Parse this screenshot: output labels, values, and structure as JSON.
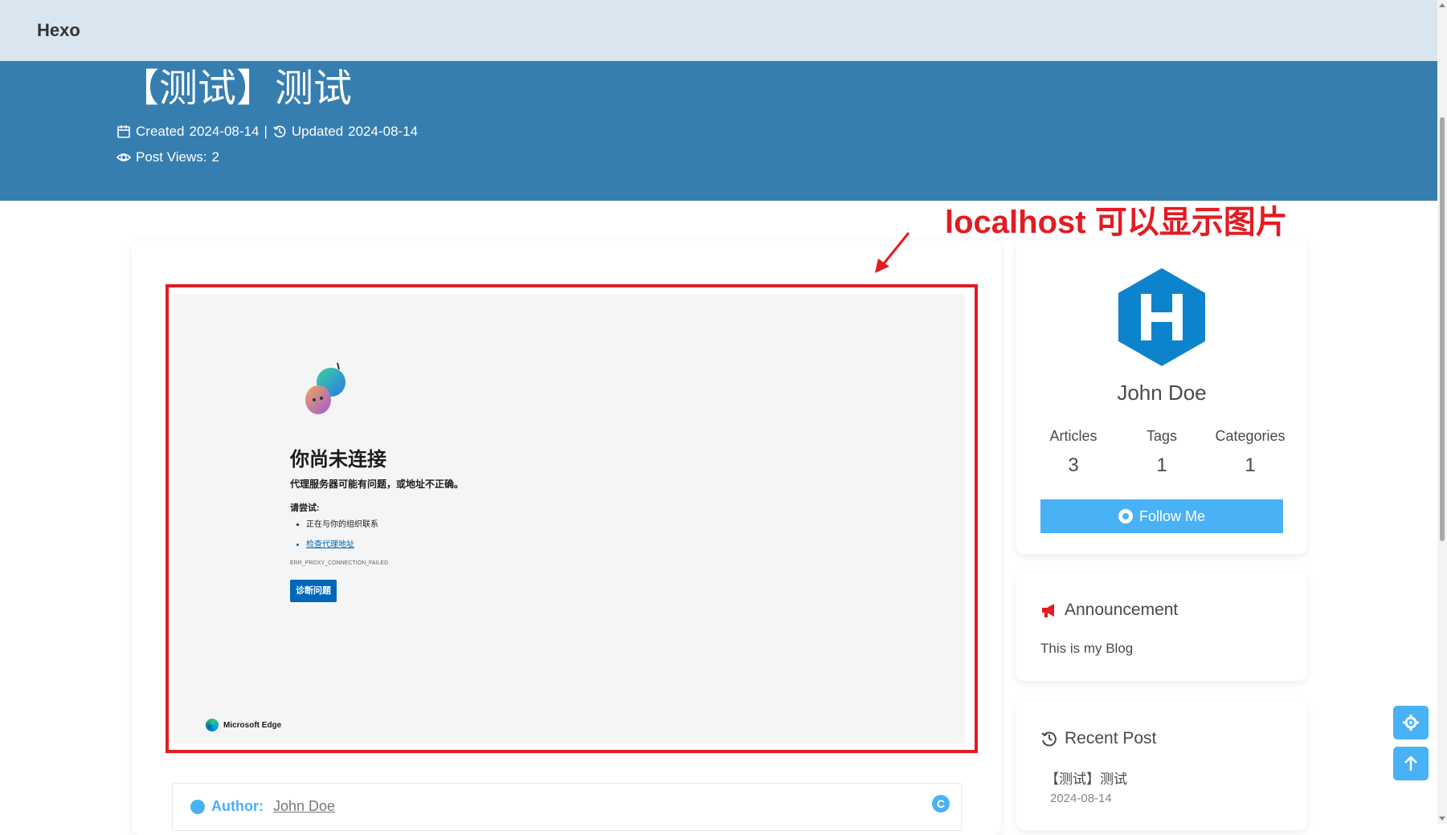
{
  "navbar": {
    "brand": "Hexo"
  },
  "post": {
    "title": "【测试】测试",
    "created_label": "Created",
    "created_date": "2024-08-14",
    "separator": "|",
    "updated_label": "Updated",
    "updated_date": "2024-08-14",
    "views_label": "Post Views:",
    "views_count": "2"
  },
  "annotation": {
    "text": "localhost 可以显示图片",
    "color": "#e21c22"
  },
  "embedded_screenshot": {
    "title": "你尚未连接",
    "subtitle": "代理服务器可能有问题，或地址不正确。",
    "try_label": "请尝试:",
    "items": [
      "正在与你的组织联系",
      "检查代理地址"
    ],
    "error_code": "ERR_PROXY_CONNECTION_FAILED",
    "button_label": "诊断问题",
    "brand": "Microsoft Edge"
  },
  "author_box": {
    "label": "Author:",
    "name": "John Doe",
    "cc_icon": "C"
  },
  "profile": {
    "name": "John Doe",
    "stats": [
      {
        "label": "Articles",
        "value": "3"
      },
      {
        "label": "Tags",
        "value": "1"
      },
      {
        "label": "Categories",
        "value": "1"
      }
    ],
    "follow_label": "Follow Me"
  },
  "announcement": {
    "title": "Announcement",
    "text": "This is my Blog"
  },
  "recent": {
    "title": "Recent Post",
    "post_title": "【测试】测试",
    "post_date": "2024-08-14"
  },
  "colors": {
    "banner": "#377eb0",
    "navbar": "#d9e6ef",
    "accent": "#49b1f5",
    "avatar": "#0e83cd"
  },
  "icons": [
    "calendar-icon",
    "history-icon",
    "eye-icon",
    "github-icon",
    "megaphone-icon",
    "clock-icon",
    "gear-icon",
    "arrow-up-icon",
    "user-circle-icon",
    "cc-icon"
  ]
}
